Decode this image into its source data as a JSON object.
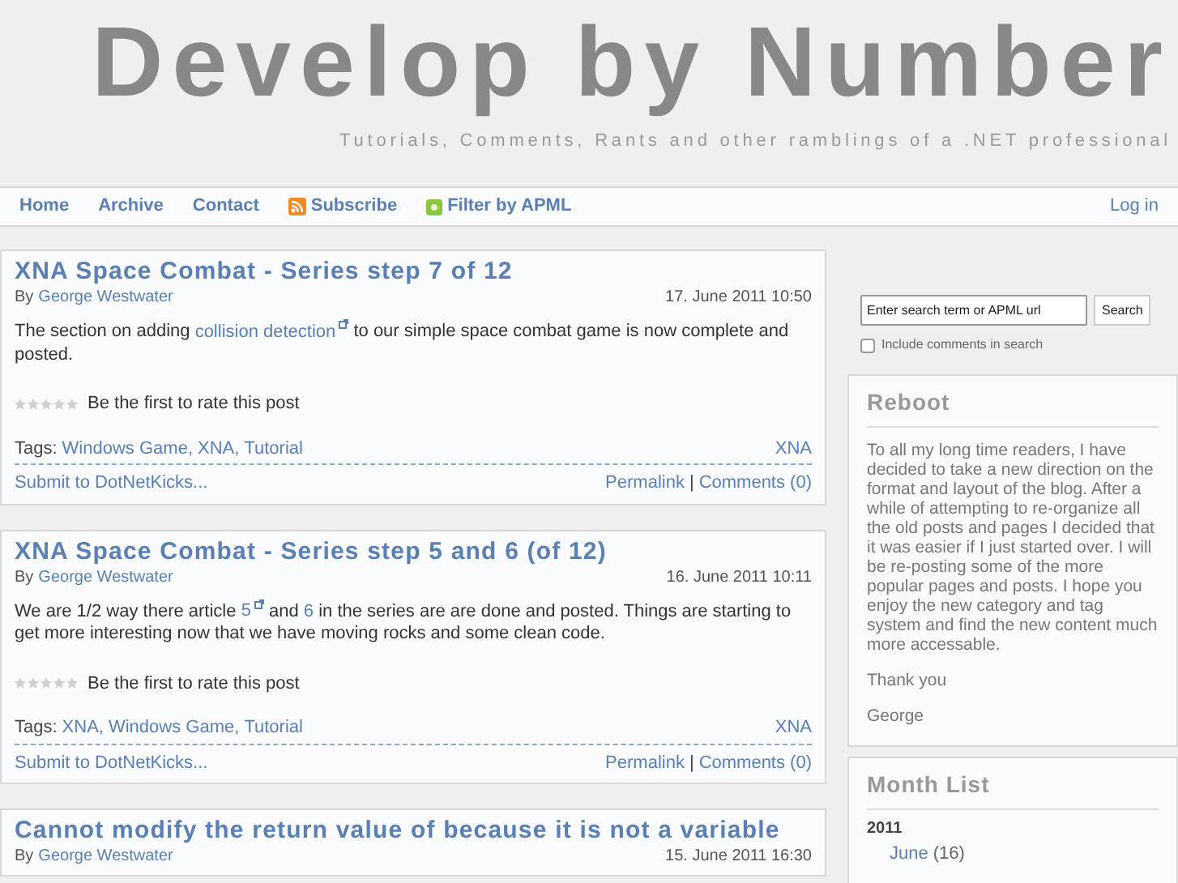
{
  "header": {
    "title": "Develop by Number",
    "tagline": "Tutorials, Comments, Rants and other ramblings of a .NET professional"
  },
  "nav": {
    "items": [
      {
        "label": "Home",
        "kind": "plain"
      },
      {
        "label": "Archive",
        "kind": "plain"
      },
      {
        "label": "Contact",
        "kind": "plain"
      },
      {
        "label": "Subscribe",
        "kind": "rss"
      },
      {
        "label": "Filter by APML",
        "kind": "apml"
      }
    ],
    "login": "Log in"
  },
  "posts": [
    {
      "title": "XNA Space Combat - Series step 7 of 12",
      "by": "By",
      "author": "George Westwater",
      "date": "17. June 2011 10:50",
      "body": [
        {
          "text": "The section on adding ",
          "kind": "text"
        },
        {
          "text": "collision detection",
          "kind": "external"
        },
        {
          "text": " to our simple space combat game is now complete and posted.",
          "kind": "text"
        }
      ],
      "stars": 0,
      "rating": "Be the first to rate this post",
      "tags_label": "Tags:",
      "tag_separator": ",",
      "tags": [
        "Windows Game",
        "XNA",
        "Tutorial"
      ],
      "category": "XNA",
      "submit": "Submit to DotNetKicks...",
      "permalink": "Permalink",
      "separator": "|",
      "comments": "Comments (0)"
    },
    {
      "title": "XNA Space Combat - Series step 5 and 6 (of 12)",
      "by": "By",
      "author": "George Westwater",
      "date": "16. June 2011 10:11",
      "body": [
        {
          "text": "We are 1/2 way there article ",
          "kind": "text"
        },
        {
          "text": "5",
          "kind": "external"
        },
        {
          "text": " and ",
          "kind": "text"
        },
        {
          "text": "6",
          "kind": "link"
        },
        {
          "text": " in the series are are done and posted. Things are starting to get more interesting now that we have moving rocks and some clean code.",
          "kind": "text"
        }
      ],
      "stars": 0,
      "rating": "Be the first to rate this post",
      "tags_label": "Tags:",
      "tag_separator": ",",
      "tags": [
        "XNA",
        "Windows Game",
        "Tutorial"
      ],
      "category": "XNA",
      "submit": "Submit to DotNetKicks...",
      "permalink": "Permalink",
      "separator": "|",
      "comments": "Comments (0)"
    },
    {
      "title": "Cannot modify the return value of because it is not a variable",
      "by": "By",
      "author": "George Westwater",
      "date": "15. June 2011 16:30"
    }
  ],
  "search": {
    "placeholder": "Enter search term or APML url",
    "button": "Search",
    "include_label": "Include comments in search",
    "include_checked": false
  },
  "reboot": {
    "title": "Reboot",
    "paragraphs": [
      "To all my long time readers, I have decided to take a new direction on the format and layout of the blog. After a while of attempting to re-organize all the old posts and pages I decided that it was easier if I just started over. I will be re-posting some of the more popular pages and posts. I hope you enjoy the new category and tag system and find the new content much more accessable.",
      "Thank you",
      "George"
    ]
  },
  "month_list": {
    "title": "Month List",
    "years": [
      {
        "year": "2011",
        "months": [
          {
            "name": "June",
            "count": "(16)"
          }
        ]
      }
    ]
  }
}
